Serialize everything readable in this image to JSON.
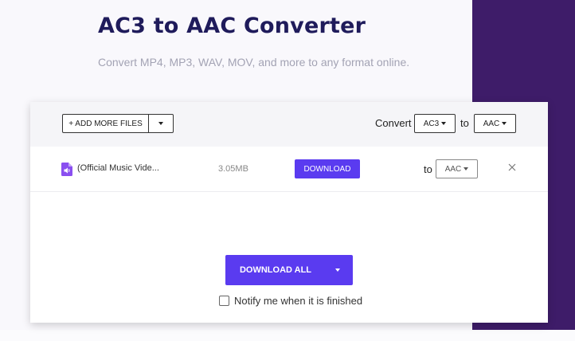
{
  "header": {
    "title": "AC3 to AAC Converter",
    "subtitle": "Convert MP4, MP3, WAV, MOV, and more to any format online."
  },
  "toolbar": {
    "add_files_label": "+ ADD MORE FILES",
    "convert_label": "Convert",
    "from_format": "AC3",
    "to_label": "to",
    "to_format": "AAC"
  },
  "files": [
    {
      "name": "(Official Music Vide...",
      "size": "3.05MB",
      "download_label": "DOWNLOAD",
      "to_label": "to",
      "target_format": "AAC",
      "icon": "audio-file-icon"
    }
  ],
  "footer": {
    "download_all_label": "DOWNLOAD ALL",
    "notify_label": "Notify me when it is finished",
    "notify_checked": false
  },
  "colors": {
    "accent": "#5a3bf0",
    "title": "#1f1b5b",
    "band": "#3e1c69",
    "file_icon": "#8a4ff0"
  }
}
